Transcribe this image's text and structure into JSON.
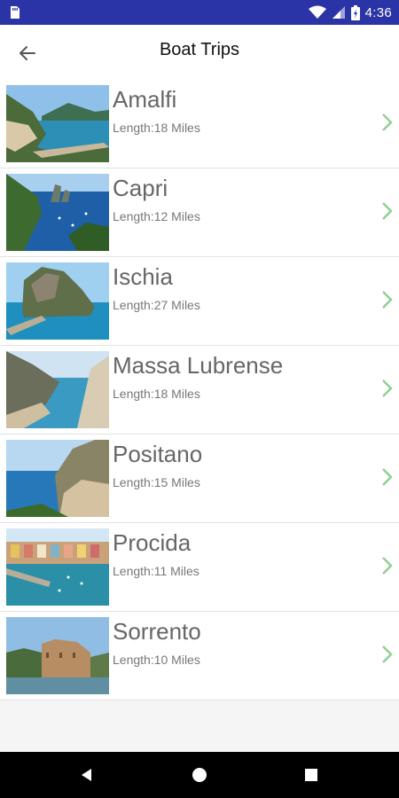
{
  "status_bar": {
    "time": "4:36",
    "icons": [
      "sd-card-icon",
      "wifi-icon",
      "signal-icon",
      "battery-icon"
    ],
    "background": "#2b34a6"
  },
  "app_bar": {
    "title": "Boat Trips",
    "back_icon": "arrow-back-icon"
  },
  "trips": [
    {
      "name": "Amalfi",
      "length": "Length:18 Miles"
    },
    {
      "name": "Capri",
      "length": "Length:12 Miles"
    },
    {
      "name": "Ischia",
      "length": "Length:27 Miles"
    },
    {
      "name": "Massa Lubrense",
      "length": "Length:18 Miles"
    },
    {
      "name": "Positano",
      "length": "Length:15 Miles"
    },
    {
      "name": "Procida",
      "length": "Length:11 Miles"
    },
    {
      "name": "Sorrento",
      "length": "Length:10 Miles"
    }
  ],
  "colors": {
    "chevron": "#8fcf8f",
    "name_text": "#666666",
    "length_text": "#777777"
  },
  "nav_bar": {
    "icons": [
      "back-triangle-icon",
      "home-circle-icon",
      "recents-square-icon"
    ]
  }
}
